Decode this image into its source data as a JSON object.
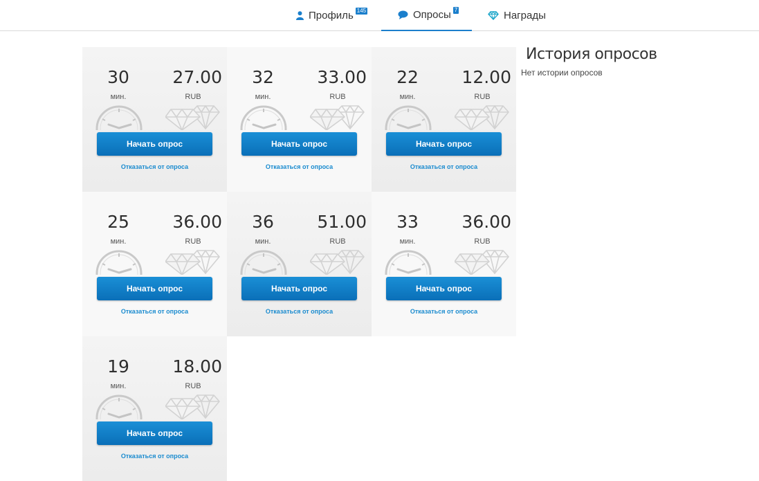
{
  "nav": {
    "profile": {
      "label": "Профиль",
      "badge": "145",
      "icon": "user-icon"
    },
    "surveys": {
      "label": "Опросы",
      "badge": "7",
      "icon": "chat-bubble-icon"
    },
    "awards": {
      "label": "Награды",
      "icon": "diamond-icon"
    }
  },
  "colors": {
    "accent": "#1b7fcc",
    "button": "#0a7cc6",
    "link": "#1a8bcf"
  },
  "surveys": [
    {
      "minutes": "30",
      "minutes_unit": "мин.",
      "reward": "27.00",
      "currency": "RUB",
      "start_label": "Начать опрос",
      "decline_label": "Отказаться от опроса"
    },
    {
      "minutes": "32",
      "minutes_unit": "мин.",
      "reward": "33.00",
      "currency": "RUB",
      "start_label": "Начать опрос",
      "decline_label": "Отказаться от опроса"
    },
    {
      "minutes": "22",
      "minutes_unit": "мин.",
      "reward": "12.00",
      "currency": "RUB",
      "start_label": "Начать опрос",
      "decline_label": "Отказаться от опроса"
    },
    {
      "minutes": "25",
      "minutes_unit": "мин.",
      "reward": "36.00",
      "currency": "RUB",
      "start_label": "Начать опрос",
      "decline_label": "Отказаться от опроса"
    },
    {
      "minutes": "36",
      "minutes_unit": "мин.",
      "reward": "51.00",
      "currency": "RUB",
      "start_label": "Начать опрос",
      "decline_label": "Отказаться от опроса"
    },
    {
      "minutes": "33",
      "minutes_unit": "мин.",
      "reward": "36.00",
      "currency": "RUB",
      "start_label": "Начать опрос",
      "decline_label": "Отказаться от опроса"
    },
    {
      "minutes": "19",
      "minutes_unit": "мин.",
      "reward": "18.00",
      "currency": "RUB",
      "start_label": "Начать опрос",
      "decline_label": "Отказаться от опроса"
    }
  ],
  "history": {
    "title": "История опросов",
    "empty_text": "Нет истории опросов"
  }
}
